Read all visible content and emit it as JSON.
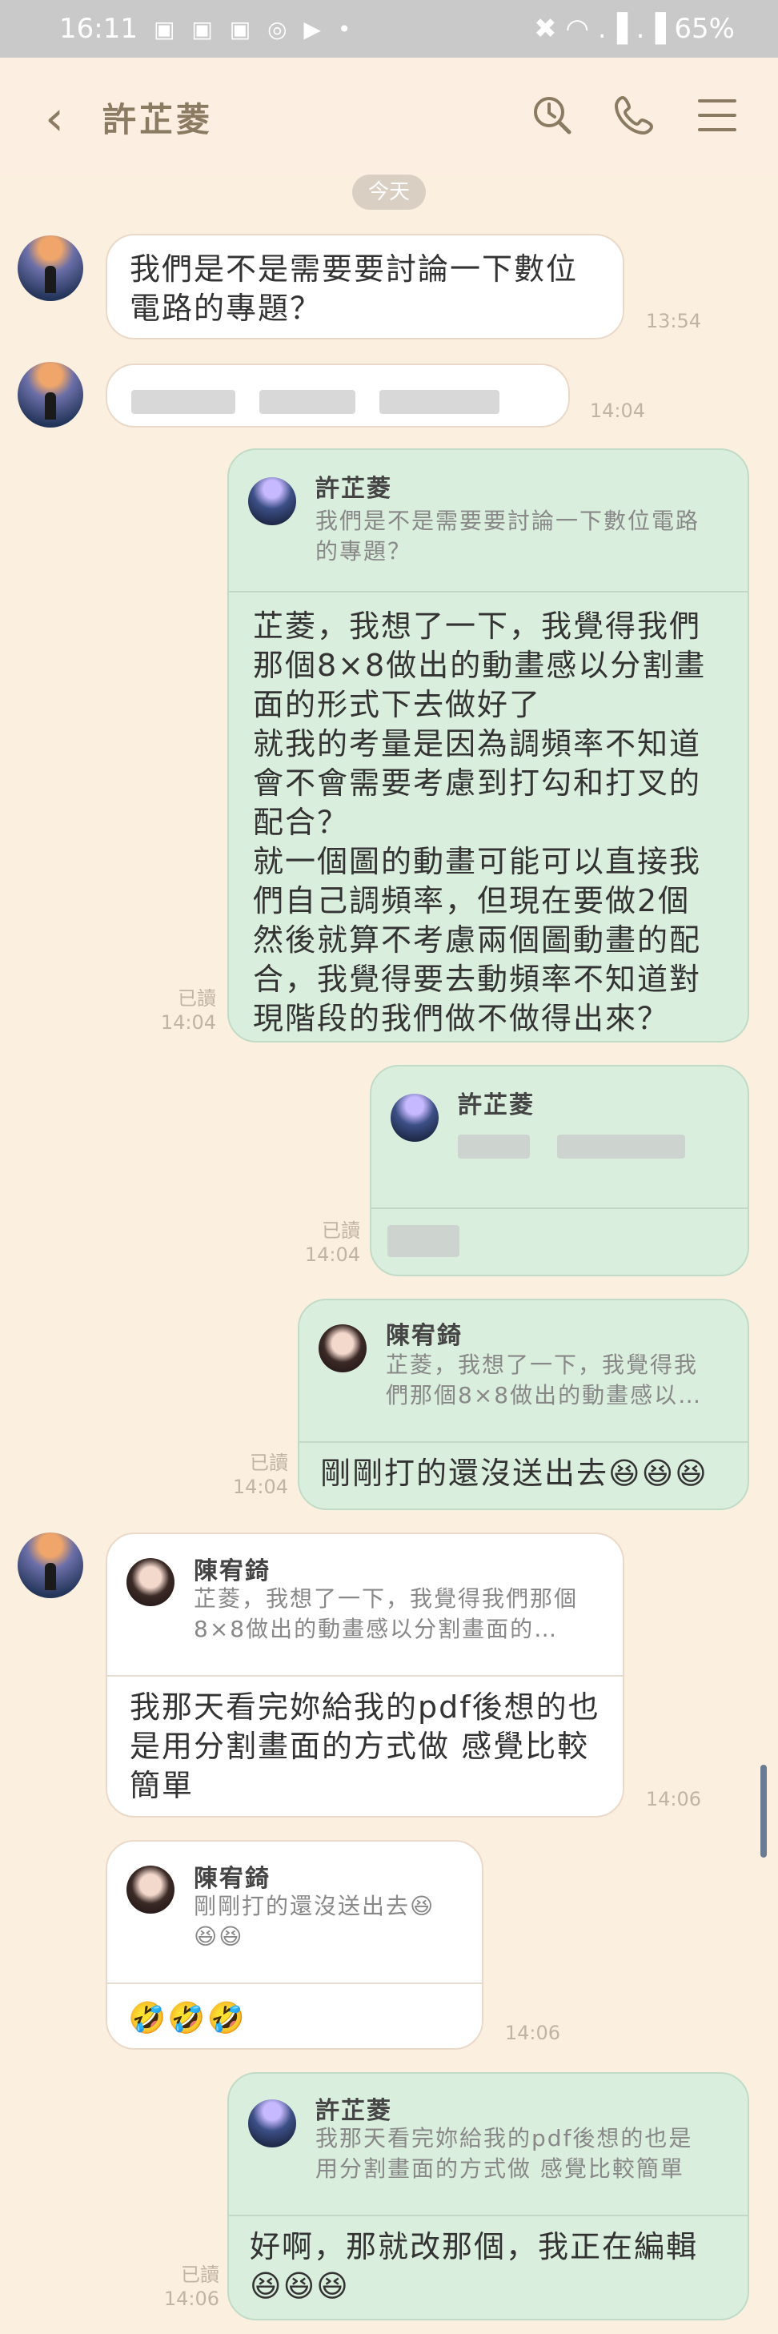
{
  "status_bar": {
    "time": "16:11",
    "battery": "65%",
    "app_icons": "▣ ▣ ▣ ◎ ▶ •",
    "right_icons": "✖ ◠ .▐ .▐"
  },
  "header": {
    "back_icon": "‹",
    "title": "許芷菱"
  },
  "date_divider": "今天",
  "messages": [
    {
      "text": "我們是不是需要要討論一下數位\n電路的專題？",
      "time": "13:54"
    },
    {
      "time": "14:04"
    },
    {
      "reply_name": "許芷菱",
      "reply_text": "我們是不是需要要討論一下數位電路\n的專題？",
      "text": "芷菱，我想了一下，我覺得我們\n那個8×8做出的動畫感以分割畫\n面的形式下去做好了\n就我的考量是因為調頻率不知道\n會不會需要考慮到打勾和打叉的\n配合？\n就一個圖的動畫可能可以直接我\n們自己調頻率，但現在要做2個\n然後就算不考慮兩個圖動畫的配\n合，我覺得要去動頻率不知道對\n現階段的我們做不做得出來？",
      "read": "已讀",
      "time": "14:04"
    },
    {
      "reply_name": "許芷菱",
      "read": "已讀",
      "time": "14:04"
    },
    {
      "reply_name": "陳宥錡",
      "reply_text": "芷菱，我想了一下，我覺得我\n們那個8×8做出的動畫感以…",
      "text": "剛剛打的還沒送出去😆😆😆",
      "read": "已讀",
      "time": "14:04"
    },
    {
      "reply_name": "陳宥錡",
      "reply_text": "芷菱，我想了一下，我覺得我們那個\n8×8做出的動畫感以分割畫面的…",
      "text": "我那天看完妳給我的pdf後想的也\n是用分割畫面的方式做 感覺比較\n簡單",
      "time": "14:06"
    },
    {
      "reply_name": "陳宥錡",
      "reply_text": "剛剛打的還沒送出去😆\n😆😆",
      "text": "🤣🤣🤣",
      "time": "14:06"
    },
    {
      "reply_name": "許芷菱",
      "reply_text": "我那天看完妳給我的pdf後想的也是\n用分割畫面的方式做 感覺比較簡單",
      "text": "好啊，那就改那個，我正在編輯\n😆😆😆",
      "read": "已讀",
      "time": "14:06"
    }
  ]
}
